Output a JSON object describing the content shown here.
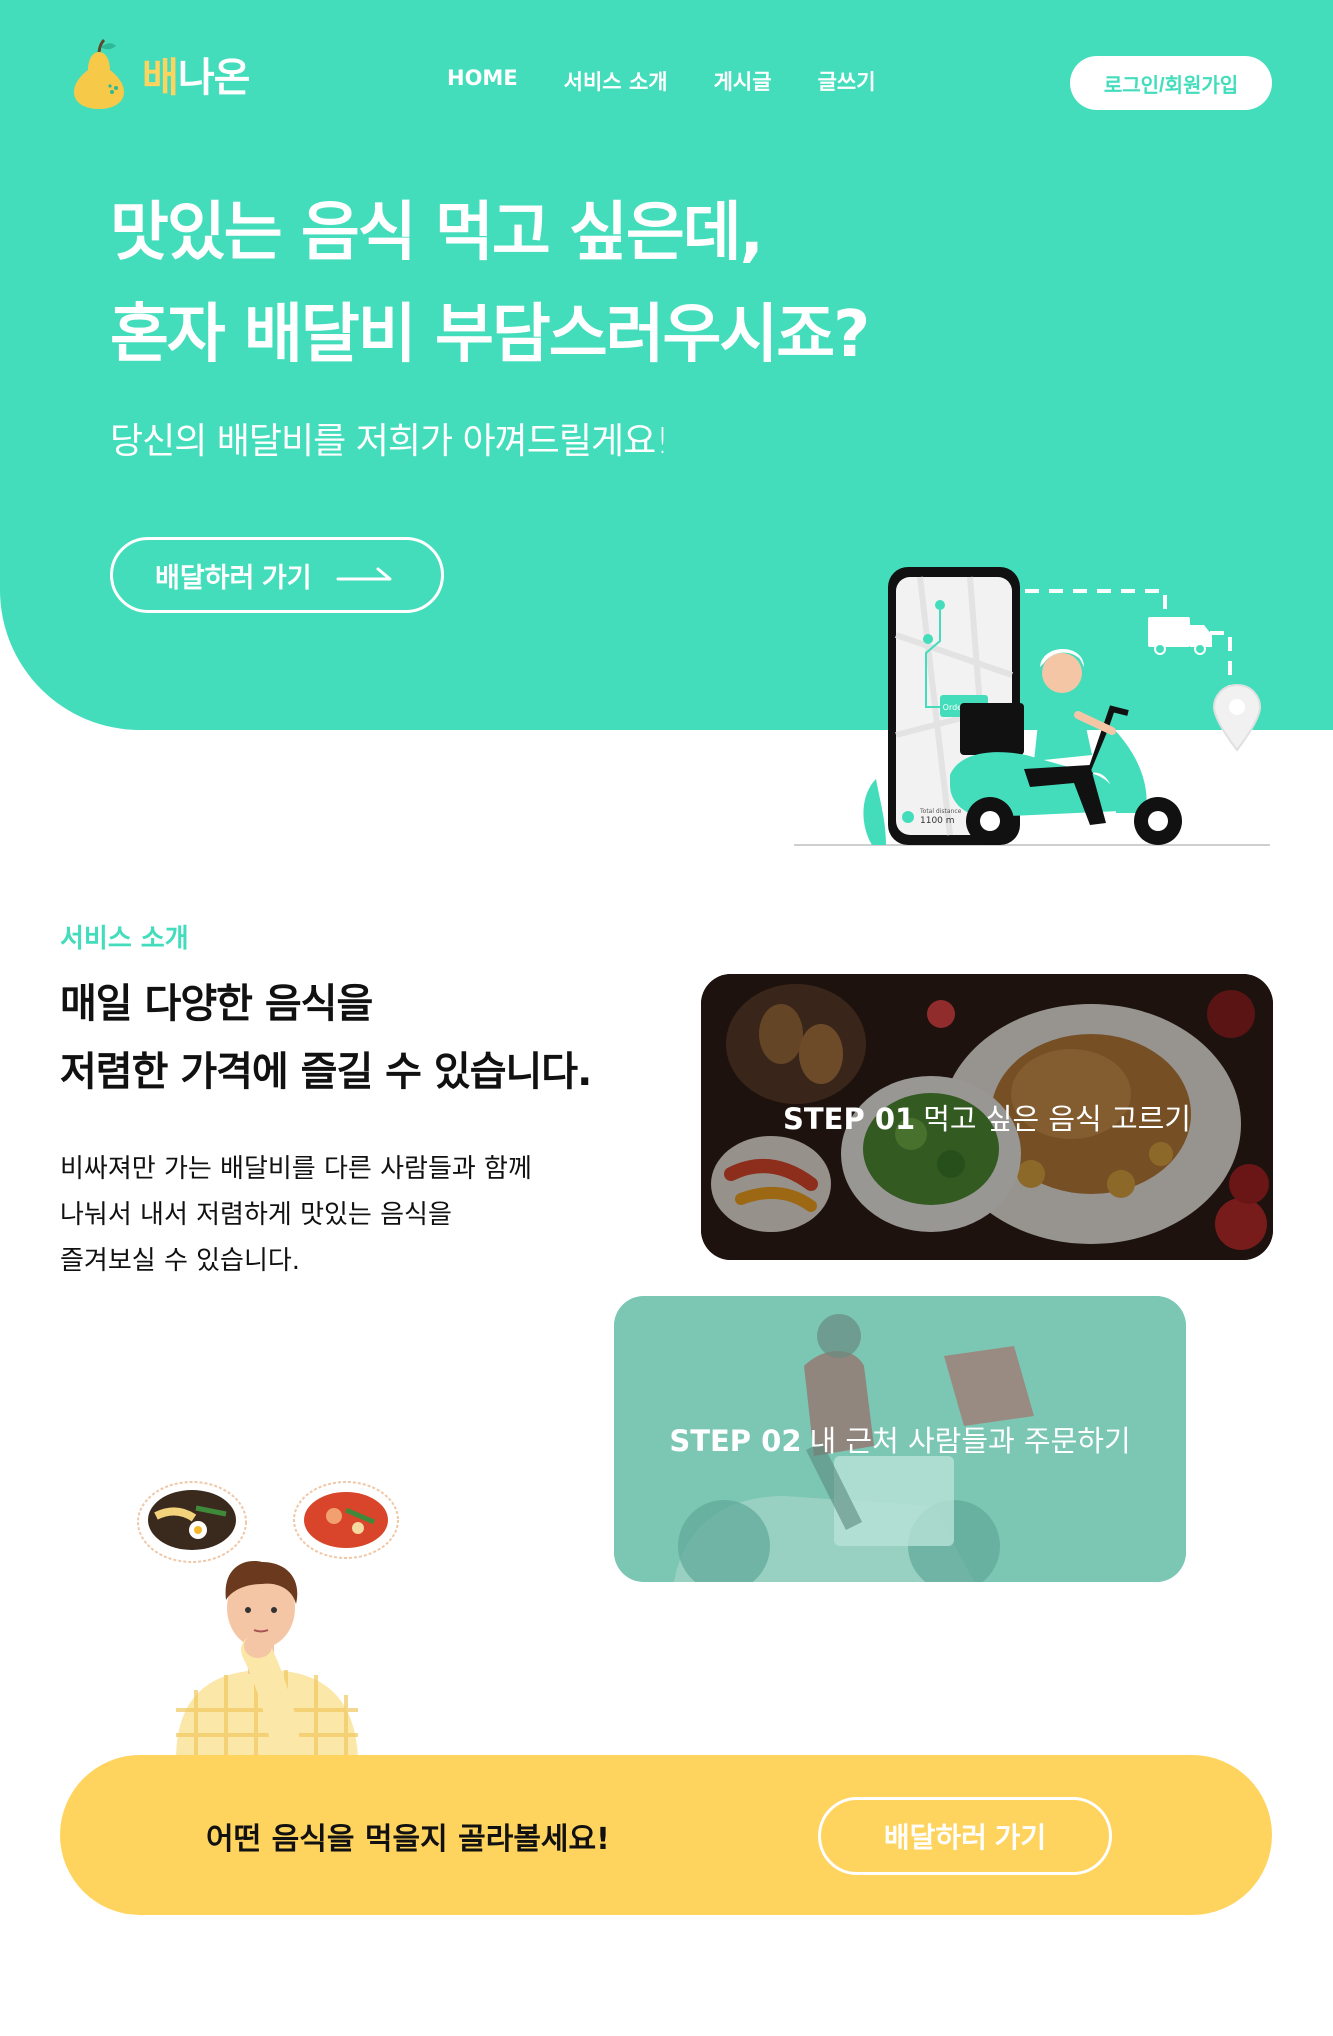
{
  "header": {
    "logo_part1": "배",
    "logo_part2": "나온",
    "nav": [
      "HOME",
      "서비스 소개",
      "게시글",
      "글쓰기"
    ],
    "login_label": "로그인/회원가입"
  },
  "hero": {
    "title_line1": "맛있는 음식 먹고 싶은데,",
    "title_line2": "혼자 배달비 부담스러우시죠?",
    "subtitle": "당신의 배달비를 저희가 아껴드릴게요!",
    "button_label": "배달하러 가기",
    "map_tag": "Order Now",
    "distance_caption": "Total distance",
    "distance_value": "1100 m"
  },
  "service": {
    "label": "서비스 소개",
    "title_line1": "매일 다양한 음식을",
    "title_line2": "저렴한 가격에 즐길 수 있습니다.",
    "desc_line1": "비싸져만 가는 배달비를 다른 사람들과 함께",
    "desc_line2": "나눠서 내서 저렴하게 맛있는 음식을",
    "desc_line3": "즐겨보실 수 있습니다.",
    "steps": [
      {
        "step": "STEP 01",
        "text": "먹고 싶은 음식 고르기"
      },
      {
        "step": "STEP 02",
        "text": "내 근처 사람들과 주문하기"
      }
    ]
  },
  "cta": {
    "text": "어떤 음식을 먹을지 골라볼세요!",
    "button_label": "배달하러 가기"
  },
  "colors": {
    "primary": "#43DDBC",
    "accent": "#FFD45E",
    "white": "#FFFFFF"
  },
  "icons": [
    "pear-logo-icon",
    "arrow-right-icon",
    "smartphone-map-icon",
    "delivery-truck-icon",
    "location-pin-icon",
    "scooter-rider-icon",
    "food-bowl-icon"
  ]
}
